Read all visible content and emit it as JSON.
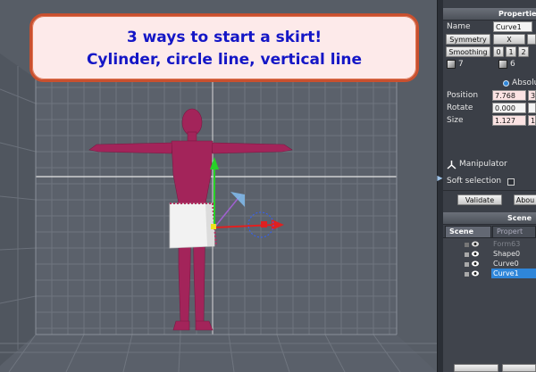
{
  "banner": {
    "line1": "3 ways to start a skirt!",
    "line2": "Cylinder, circle line, vertical line"
  },
  "properties_panel": {
    "title": "Properties",
    "name_label": "Name",
    "name_value": "Curve1",
    "symmetry_label": "Symmetry",
    "symmetry_x": "X",
    "smoothing_label": "Smoothing",
    "smoothing_options": [
      "0",
      "1",
      "2"
    ],
    "count_a": "7",
    "count_b": "6",
    "absolute_label": "Absolu",
    "position_label": "Position",
    "position_value": "7.768",
    "position_value_2": "3",
    "rotate_label": "Rotate",
    "rotate_value": "0.000",
    "size_label": "Size",
    "size_value": "1.127",
    "size_value_2": "1",
    "manipulator_label": "Manipulator",
    "soft_selection_label": "Soft selection",
    "validate_label": "Validate",
    "about_label": "Abou"
  },
  "scene_panel": {
    "title": "Scene",
    "tabs": [
      "Scene tree",
      "Propert"
    ],
    "items": [
      {
        "name": "Form63",
        "state": "dim"
      },
      {
        "name": "Shape0",
        "state": "normal"
      },
      {
        "name": "Curve0",
        "state": "normal"
      },
      {
        "name": "Curve1",
        "state": "selected"
      }
    ]
  },
  "colors": {
    "banner_text": "#1416c6",
    "banner_border": "#c9502f",
    "banner_fill": "#fdeaea",
    "figure": "#a3245a",
    "skirt": "#f2f2f2",
    "selection": "#2f86d9"
  }
}
